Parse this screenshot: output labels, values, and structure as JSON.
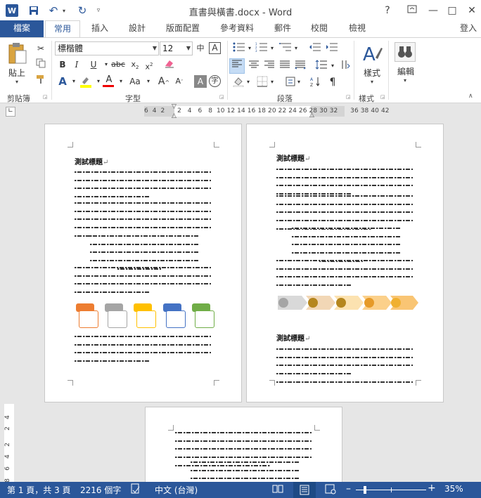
{
  "window": {
    "title": "直書與橫書.docx - Word",
    "app_icon": "W"
  },
  "quick_access": {
    "save": "save-icon",
    "undo": "undo-icon",
    "redo": "redo-icon",
    "more": "customize-icon"
  },
  "window_controls": {
    "help": "?",
    "restore": "▢",
    "minimize": "—",
    "maximize": "□",
    "close": "✕"
  },
  "tabs": [
    "檔案",
    "常用",
    "插入",
    "設計",
    "版面配置",
    "參考資料",
    "郵件",
    "校閱",
    "檢視"
  ],
  "signin": "登入",
  "ribbon": {
    "clipboard": {
      "paste_label": "貼上",
      "group": "剪貼簿"
    },
    "font": {
      "name": "標楷體",
      "size": "12",
      "group": "字型"
    },
    "paragraph": {
      "group": "段落"
    },
    "styles": {
      "label": "樣式",
      "group": "樣式"
    },
    "editing": {
      "label": "編輯"
    }
  },
  "ruler": {
    "numbers": "6  4  2      2   4   6   8  10 12 14 16 18 20 22 24 26 28 30 32      36 38 40 42"
  },
  "vruler": [
    "4",
    "2",
    "2",
    "4",
    "6",
    "8"
  ],
  "document": {
    "heading": "測試標題",
    "para_mark": "↵"
  },
  "status": {
    "page": "第 1 頁，共 3 頁",
    "words": "2216 個字",
    "language": "中文 (台灣)",
    "zoom": "35%"
  },
  "colors": {
    "accent": "#2b579a"
  }
}
